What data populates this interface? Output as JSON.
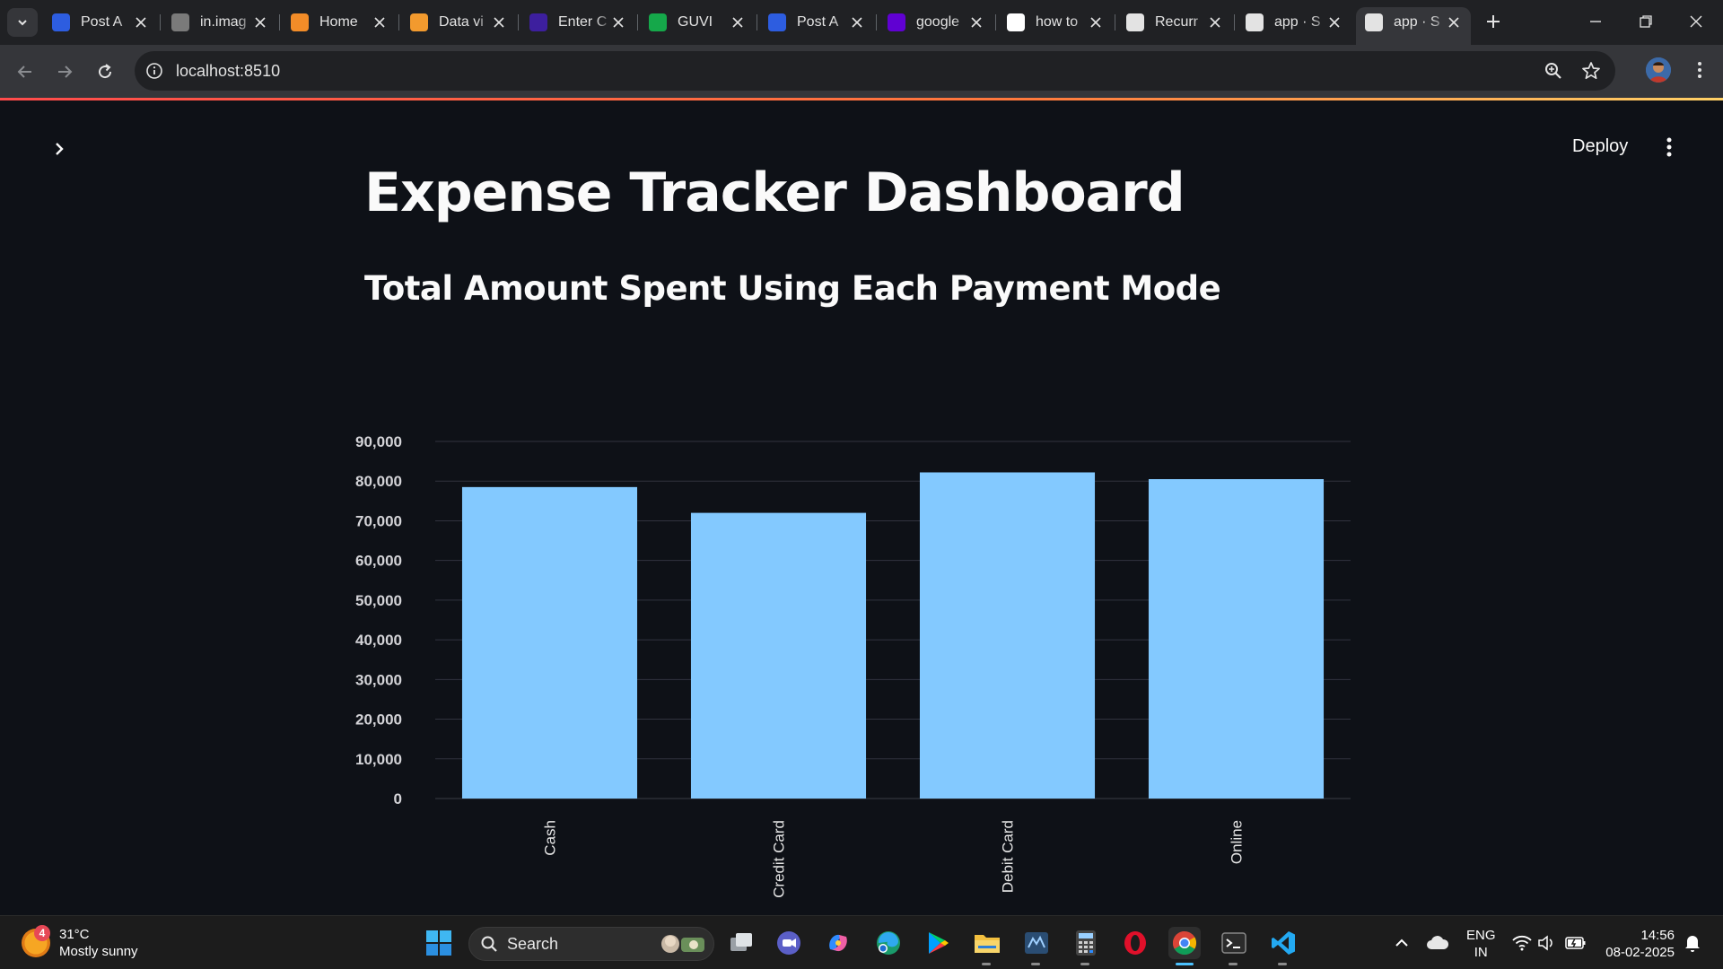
{
  "browser": {
    "tabs": [
      {
        "title": "Post A",
        "favicon": "zoom-icon",
        "color": "#2d5de0",
        "active": false
      },
      {
        "title": "in.imag",
        "favicon": "image-icon",
        "color": "#7a7a7a",
        "active": false
      },
      {
        "title": "Home",
        "favicon": "loading-ring-icon",
        "color": "#f28c28",
        "active": false
      },
      {
        "title": "Data vi",
        "favicon": "book-icon",
        "color": "#f29a2e",
        "active": false
      },
      {
        "title": "Enter C",
        "favicon": "kaggle-icon",
        "color": "#3d1f9e",
        "active": false
      },
      {
        "title": "GUVI",
        "favicon": "guvi-icon",
        "color": "#15a84a",
        "active": false
      },
      {
        "title": "Post A",
        "favicon": "zoom-icon",
        "color": "#2d5de0",
        "active": false
      },
      {
        "title": "google",
        "favicon": "yahoo-icon",
        "color": "#6001d2",
        "active": false
      },
      {
        "title": "how to",
        "favicon": "google-icon",
        "color": "#ffffff",
        "active": false
      },
      {
        "title": "Recurr",
        "favicon": "openai-icon",
        "color": "#e3e3e3",
        "active": false
      },
      {
        "title": "app · S",
        "favicon": "streamlit-crown-icon",
        "color": "#e3e3e3",
        "active": false
      },
      {
        "title": "app · S",
        "favicon": "streamlit-crown-icon",
        "color": "#e3e3e3",
        "active": true
      }
    ],
    "url": "localhost:8510"
  },
  "app": {
    "deploy_label": "Deploy",
    "title": "Expense Tracker Dashboard",
    "chart_heading": "Total Amount Spent Using Each Payment Mode"
  },
  "chart_data": {
    "type": "bar",
    "categories": [
      "Cash",
      "Credit Card",
      "Debit Card",
      "Online"
    ],
    "values": [
      78500,
      72000,
      82200,
      80500
    ],
    "ylim": [
      0,
      90000
    ],
    "yticks": [
      0,
      10000,
      20000,
      30000,
      40000,
      50000,
      60000,
      70000,
      80000,
      90000
    ],
    "ytick_labels": [
      "0",
      "10,000",
      "20,000",
      "30,000",
      "40,000",
      "50,000",
      "60,000",
      "70,000",
      "80,000",
      "90,000"
    ],
    "xlabel": "",
    "ylabel": "",
    "bar_color": "#83c9ff",
    "grid": true
  },
  "taskbar": {
    "weather_temp": "31°C",
    "weather_desc": "Mostly sunny",
    "weather_badge": "4",
    "search_label": "Search",
    "lang_line1": "ENG",
    "lang_line2": "IN",
    "time": "14:56",
    "date": "08-02-2025"
  }
}
